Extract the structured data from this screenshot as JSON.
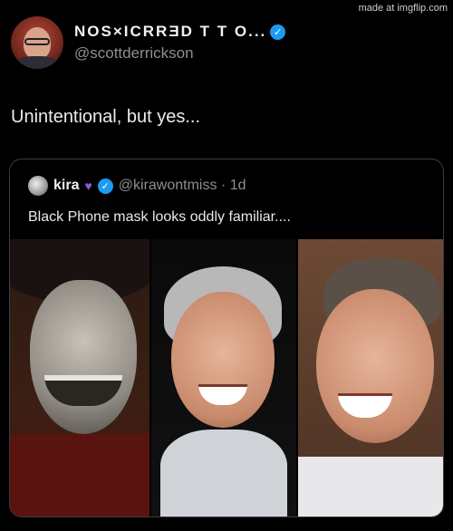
{
  "watermark": "made at imgflip.com",
  "tweet": {
    "display_name": "NOS×ICRRƎD T T O...",
    "handle": "@scottderrickson",
    "text": "Unintentional, but yes..."
  },
  "quote": {
    "name": "kira",
    "heart": "♥",
    "handle_time": "@kirawontmiss · 1d",
    "text": "Black Phone mask looks oddly familiar....",
    "media_panels": [
      "masked-figure-photo",
      "smiling-man-photo",
      "laughing-man-photo"
    ]
  },
  "icons": {
    "verified": "✓"
  },
  "colors": {
    "background": "#000000",
    "verified": "#1d9bf0",
    "handle": "#8b8f94",
    "heart": "#8a5bd8"
  }
}
